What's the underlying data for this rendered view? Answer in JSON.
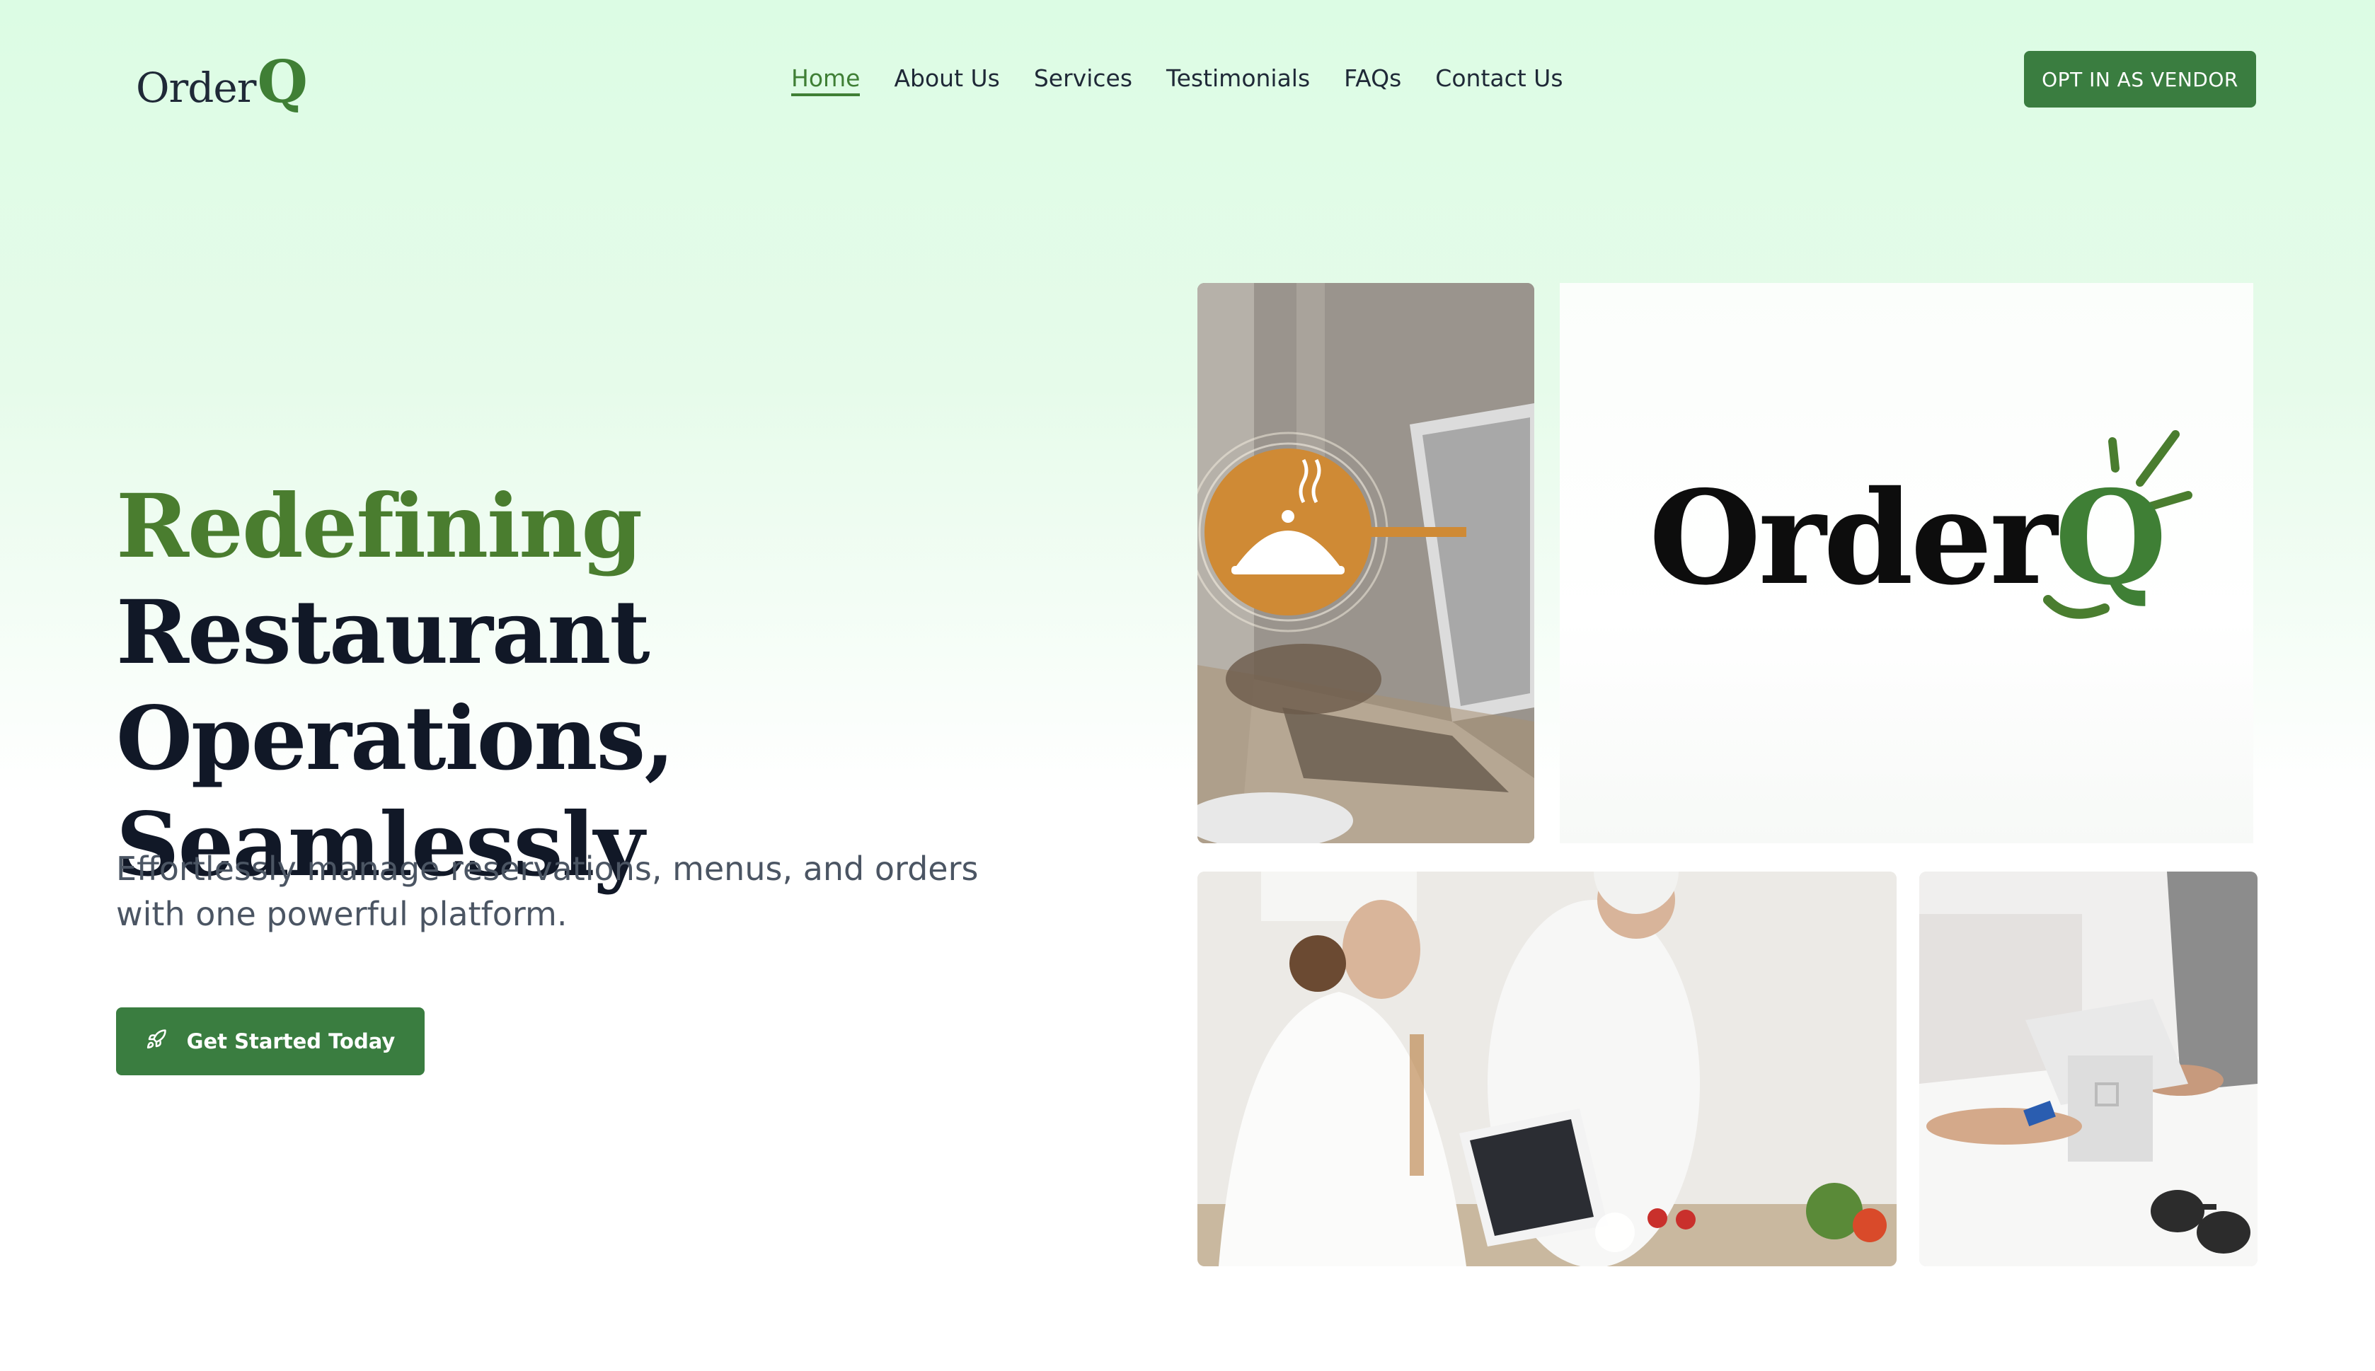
{
  "header": {
    "logo": {
      "text": "Order",
      "accent": "Q"
    },
    "nav": [
      {
        "label": "Home",
        "active": true
      },
      {
        "label": "About Us",
        "active": false
      },
      {
        "label": "Services",
        "active": false
      },
      {
        "label": "Testimonials",
        "active": false
      },
      {
        "label": "FAQs",
        "active": false
      },
      {
        "label": "Contact Us",
        "active": false
      }
    ],
    "vendor_button": "OPT IN AS VENDOR"
  },
  "hero": {
    "title_accent": "Redefining",
    "title_line1": "Restaurant Operations,",
    "title_line2": "Seamlessly",
    "subtitle": "Effortlessly manage reservations, menus, and orders with one powerful platform.",
    "cta": {
      "label": "Get Started Today",
      "icon": "rocket-icon"
    }
  },
  "gallery": {
    "brand_logo": {
      "text": "Order",
      "accent": "Q"
    },
    "tiles": [
      {
        "subject": "laptop-with-cloche-icon"
      },
      {
        "subject": "orderq-logo"
      },
      {
        "subject": "chefs-with-tablet"
      },
      {
        "subject": "card-payment-terminal"
      }
    ]
  },
  "colors": {
    "brand_green": "#3a7d40",
    "accent_green": "#4a7d2f",
    "heading": "#111827",
    "body_text": "#4b5563",
    "hero_bg_top": "#dcfce4"
  }
}
